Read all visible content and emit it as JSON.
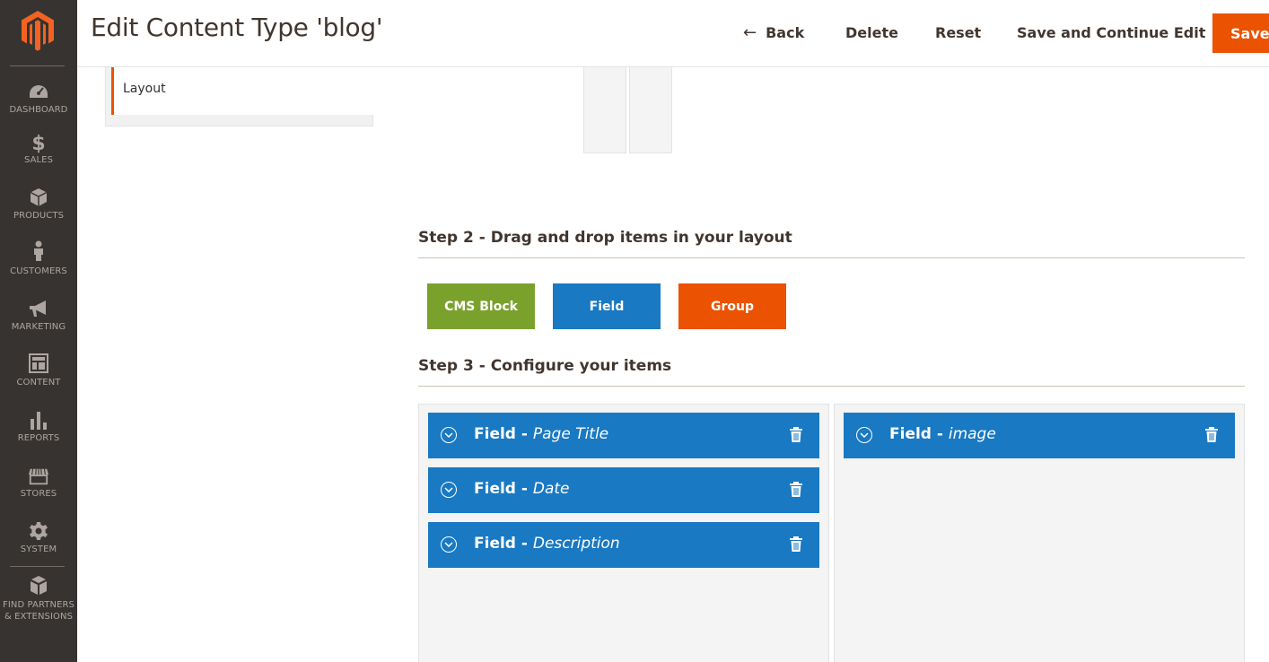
{
  "sidebar": {
    "logo": "magento-logo",
    "items": [
      {
        "label": "DASHBOARD",
        "icon": "dashboard-icon"
      },
      {
        "label": "SALES",
        "icon": "dollar-icon"
      },
      {
        "label": "PRODUCTS",
        "icon": "cube-icon"
      },
      {
        "label": "CUSTOMERS",
        "icon": "person-icon"
      },
      {
        "label": "MARKETING",
        "icon": "megaphone-icon"
      },
      {
        "label": "CONTENT",
        "icon": "layout-icon"
      },
      {
        "label": "REPORTS",
        "icon": "bar-chart-icon"
      },
      {
        "label": "STORES",
        "icon": "storefront-icon"
      },
      {
        "label": "SYSTEM",
        "icon": "gear-icon"
      },
      {
        "label_line1": "FIND PARTNERS",
        "label_line2": "& EXTENSIONS",
        "icon": "boxes-icon"
      }
    ]
  },
  "header": {
    "title": "Edit Content Type 'blog'",
    "back_label": "Back",
    "delete_label": "Delete",
    "reset_label": "Reset",
    "save_continue_label": "Save and Continue Edit",
    "save_label": "Save"
  },
  "tabs": {
    "layout_label": "Layout"
  },
  "step2": {
    "title": "Step 2 - Drag and drop items in your layout",
    "buttons": [
      {
        "label": "CMS Block",
        "color": "#7ba12d"
      },
      {
        "label": "Field",
        "color": "#1979c3"
      },
      {
        "label": "Group",
        "color": "#eb5202"
      }
    ]
  },
  "step3": {
    "title": "Step 3 - Configure your items",
    "column1": [
      {
        "prefix": "Field - ",
        "name": "Page Title"
      },
      {
        "prefix": "Field - ",
        "name": "Date"
      },
      {
        "prefix": "Field - ",
        "name": "Description"
      }
    ],
    "column2": [
      {
        "prefix": "Field - ",
        "name": "image"
      }
    ]
  },
  "colors": {
    "sidebar_bg": "#373330",
    "accent_orange": "#eb5202",
    "field_blue": "#1979c3",
    "cms_green": "#7ba12d"
  }
}
